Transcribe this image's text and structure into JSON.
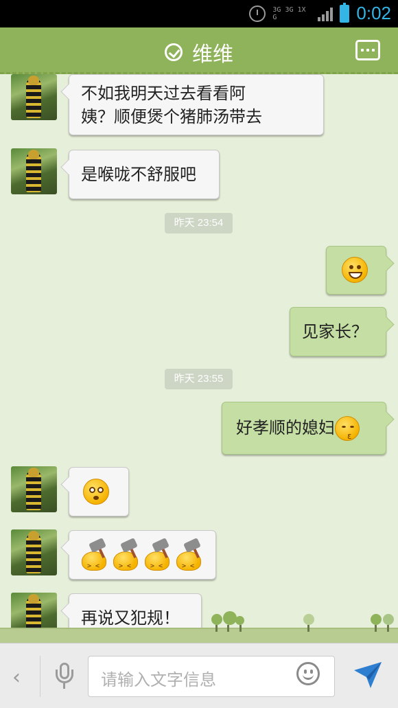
{
  "status_bar": {
    "network_label": "3G 3G 1X G",
    "time": "0:02"
  },
  "header": {
    "title": "维维",
    "check_icon": "verified-check-icon",
    "more_icon": "more-options-icon"
  },
  "messages": [
    {
      "side": "in",
      "type": "text",
      "text_line1": "不如我明天过去看看阿",
      "text_line2": "姨？顺便煲个猪肺汤带去"
    },
    {
      "side": "in",
      "type": "text",
      "text": "是喉咙不舒服吧"
    },
    {
      "side": "out",
      "type": "emoji",
      "emoji": "grin-emoji"
    },
    {
      "side": "out",
      "type": "text",
      "text": "见家长？"
    },
    {
      "side": "out",
      "type": "text_emoji",
      "text": "好孝顺的媳妇",
      "emoji": "kiss-emoji"
    },
    {
      "side": "in",
      "type": "emoji",
      "emoji": "surprised-emoji"
    },
    {
      "side": "in",
      "type": "emoji_row",
      "emoji": "hammer-emoji",
      "count": 4
    },
    {
      "side": "in",
      "type": "text",
      "text": "再说又犯规！"
    }
  ],
  "timestamps": [
    "昨天 23:54",
    "昨天 23:55"
  ],
  "input_bar": {
    "placeholder": "请输入文字信息",
    "back_icon": "back-chevron-icon",
    "voice_icon": "microphone-icon",
    "emoji_icon": "smiley-icon",
    "send_icon": "send-icon"
  },
  "colors": {
    "header_bg": "#8fb35a",
    "chat_bg": "#e6efd9",
    "outgoing_bubble": "#c5dea3",
    "incoming_bubble": "#f6f6f6",
    "accent_time": "#33b5e5",
    "send_icon": "#2f7fd0"
  }
}
